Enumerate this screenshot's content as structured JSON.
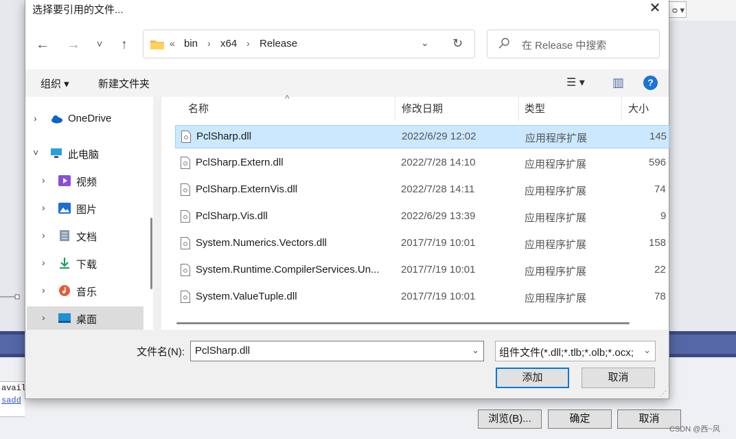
{
  "background": {
    "combo_text": "ᴑ ▾",
    "code_lines": [
      "avail",
      "sadd"
    ],
    "buttons": [
      "浏览(B)...",
      "确定",
      "取消"
    ],
    "watermark": "CSDN @西~风"
  },
  "dialog": {
    "title": "选择要引用的文件...",
    "close_glyph": "✕",
    "nav": {
      "back": "←",
      "forward": "→",
      "recent": "˅",
      "up": "↑"
    },
    "address": {
      "overflow": "«",
      "crumbs": [
        "bin",
        "x64",
        "Release"
      ],
      "sep": "›",
      "dropdown": "⌄",
      "refresh": "↻"
    },
    "search": {
      "placeholder": "在 Release 中搜索"
    },
    "toolbar": {
      "organize": "组织 ▾",
      "new_folder": "新建文件夹",
      "view_glyph": "☰ ▾",
      "preview_glyph": "▥",
      "help": "?"
    },
    "navpane": {
      "items": [
        {
          "label": "OneDrive",
          "chevron": "›"
        },
        {
          "label": "此电脑",
          "chevron": "˅"
        },
        {
          "label": "视频",
          "chevron": "›"
        },
        {
          "label": "图片",
          "chevron": "›"
        },
        {
          "label": "文档",
          "chevron": "›"
        },
        {
          "label": "下载",
          "chevron": "›"
        },
        {
          "label": "音乐",
          "chevron": "›"
        },
        {
          "label": "桌面",
          "chevron": "›"
        }
      ]
    },
    "columns": {
      "name": "名称",
      "date": "修改日期",
      "type": "类型",
      "size": "大小",
      "sort_glyph": "^"
    },
    "files": [
      {
        "name": "PclSharp.dll",
        "date": "2022/6/29 12:02",
        "type": "应用程序扩展",
        "size": "145"
      },
      {
        "name": "PclSharp.Extern.dll",
        "date": "2022/7/28 14:10",
        "type": "应用程序扩展",
        "size": "596"
      },
      {
        "name": "PclSharp.ExternVis.dll",
        "date": "2022/7/28 14:11",
        "type": "应用程序扩展",
        "size": "74"
      },
      {
        "name": "PclSharp.Vis.dll",
        "date": "2022/6/29 13:39",
        "type": "应用程序扩展",
        "size": "9"
      },
      {
        "name": "System.Numerics.Vectors.dll",
        "date": "2017/7/19 10:01",
        "type": "应用程序扩展",
        "size": "158"
      },
      {
        "name": "System.Runtime.CompilerServices.Un...",
        "date": "2017/7/19 10:01",
        "type": "应用程序扩展",
        "size": "22"
      },
      {
        "name": "System.ValueTuple.dll",
        "date": "2017/7/19 10:01",
        "type": "应用程序扩展",
        "size": "78"
      }
    ],
    "filename": {
      "label": "文件名(N):",
      "value": "PclSharp.dll",
      "dropdown": "⌄"
    },
    "filetype": {
      "value": "组件文件(*.dll;*.tlb;*.olb;*.ocx;",
      "dropdown": "⌄"
    },
    "add_button": "添加",
    "cancel_button": "取消",
    "grip": "⋰"
  }
}
